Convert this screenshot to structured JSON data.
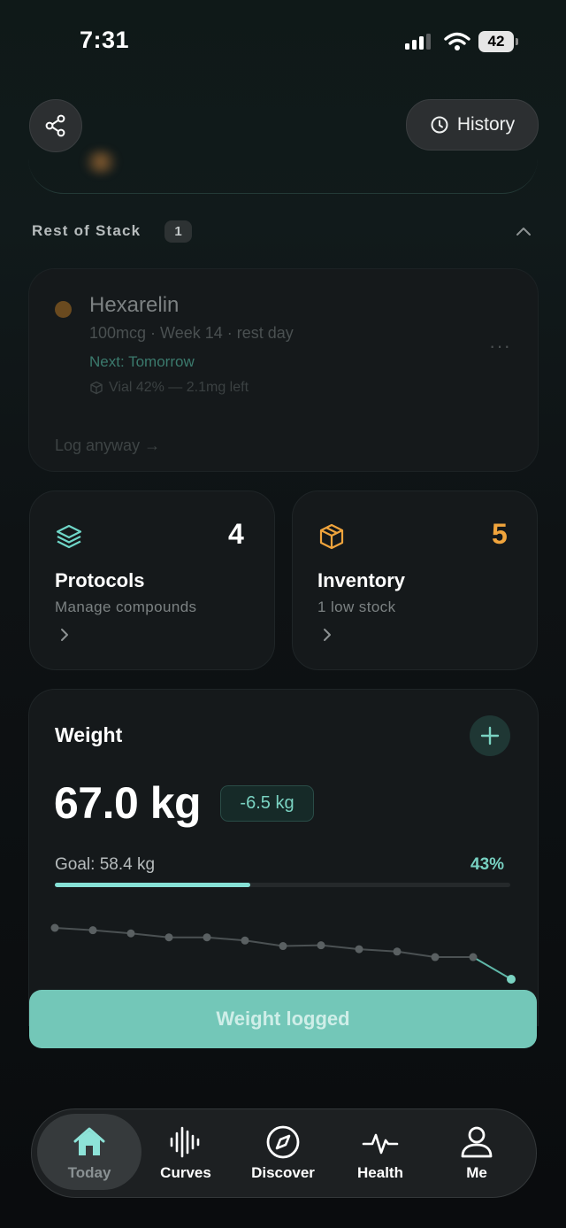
{
  "status_bar": {
    "time": "7:31",
    "battery": "42"
  },
  "header": {
    "history_label": "History"
  },
  "rest_of_stack": {
    "title": "Rest of Stack",
    "count": "1",
    "item": {
      "name": "Hexarelin",
      "details": "100mcg · Week 14 · rest day",
      "next": "Next: Tomorrow",
      "vial": "Vial 42% — 2.1mg left",
      "more": "···",
      "log_anyway": "Log anyway →"
    }
  },
  "cards": {
    "protocols": {
      "title": "Protocols",
      "subtitle": "Manage compounds",
      "count": "4"
    },
    "inventory": {
      "title": "Inventory",
      "subtitle": "1 low stock",
      "count": "5"
    }
  },
  "weight": {
    "title": "Weight",
    "value": "67.0 kg",
    "delta": "-6.5 kg",
    "goal": "Goal: 58.4 kg",
    "progress_percent": "43%",
    "progress_fraction": 0.43,
    "history": [
      73.5,
      73.2,
      72.8,
      72.3,
      72.3,
      71.9,
      71.2,
      71.3,
      70.8,
      70.5,
      69.8,
      69.8,
      67.0
    ]
  },
  "logged_button": "Weight logged",
  "tabs": [
    {
      "label": "Today",
      "icon": "home-icon",
      "active": true
    },
    {
      "label": "Curves",
      "icon": "waveform-icon",
      "active": false
    },
    {
      "label": "Discover",
      "icon": "compass-icon",
      "active": false
    },
    {
      "label": "Health",
      "icon": "heartbeat-icon",
      "active": false
    },
    {
      "label": "Me",
      "icon": "person-icon",
      "active": false
    }
  ],
  "colors": {
    "accent": "#77d0c1",
    "inventory": "#f0a43c",
    "protocols": "#6fd6c8"
  }
}
